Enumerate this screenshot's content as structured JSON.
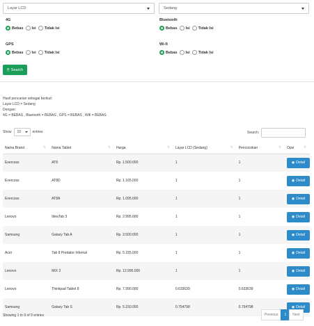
{
  "filters": {
    "layar_select": "Layar LCD",
    "ukuran_select": "Sedang",
    "groups": [
      {
        "label": "4G",
        "options": [
          "Bebas",
          "Isi",
          "Tidak Isi"
        ],
        "selected": "Bebas"
      },
      {
        "label": "Bluetooth",
        "options": [
          "Bebas",
          "Isi",
          "Tidak Isi"
        ],
        "selected": "Bebas"
      },
      {
        "label": "GPS",
        "options": [
          "Bebas",
          "Isi",
          "Tidak Isi"
        ],
        "selected": "Bebas"
      },
      {
        "label": "Wi-fi",
        "options": [
          "Bebas",
          "Isi",
          "Tidak Isi"
        ],
        "selected": "Bebas"
      }
    ],
    "search_label": "Search"
  },
  "result": {
    "line1": "Hasil pencarian sebagai berikut:",
    "line2": "Layar LCD = Sedang",
    "line3": "Dengan:",
    "line4": "4G = BEBAS , Bluetooth = BEBAS , GPS = BEBAS , Wifi = BEBAS"
  },
  "table_controls": {
    "show_label": "Show",
    "show_value": "10",
    "entries_label": "entries",
    "search_label": "Search:"
  },
  "table": {
    "headers": [
      "Nama Brand",
      "Nama Tablet",
      "Harga",
      "Layar LCD (Sedang)",
      "Pencocokan",
      "Opsi"
    ],
    "detail_label": "Detail",
    "rows": [
      [
        "Evercoss",
        "AT8",
        "Rp. 1.500.000",
        "1",
        "1"
      ],
      [
        "Evercoss",
        "AT8D",
        "Rp. 1.165.000",
        "1",
        "1"
      ],
      [
        "Evercoss",
        "AT8A",
        "Rp. 1.095.000",
        "1",
        "1"
      ],
      [
        "Lenovo",
        "IdeaTab 3",
        "Rp. 2.995.000",
        "1",
        "1"
      ],
      [
        "Samsung",
        "Galaxy Tab A",
        "Rp. 3.500.000",
        "1",
        "1"
      ],
      [
        "Acer",
        "Tab 8 Predator Infernal",
        "Rp. 5.155.000",
        "1",
        "1"
      ],
      [
        "Lenovo",
        "MIX 2",
        "Rp. 12.995.000",
        "1",
        "1"
      ],
      [
        "Lenovo",
        "Thinkpad Tablet 8",
        "Rp. 7.990.000",
        "0.633639",
        "0.633639"
      ],
      [
        "Samsung",
        "Galaxy Tab S",
        "Rp. 5.150.000",
        "0.754798",
        "0.754798"
      ]
    ]
  },
  "footer": {
    "info": "Showing 1 to 9 of 9 entries",
    "previous": "Previous",
    "page": "1",
    "next": "Next"
  },
  "colors": {
    "green": "#1a9e59",
    "blue": "#2e8bc9"
  }
}
